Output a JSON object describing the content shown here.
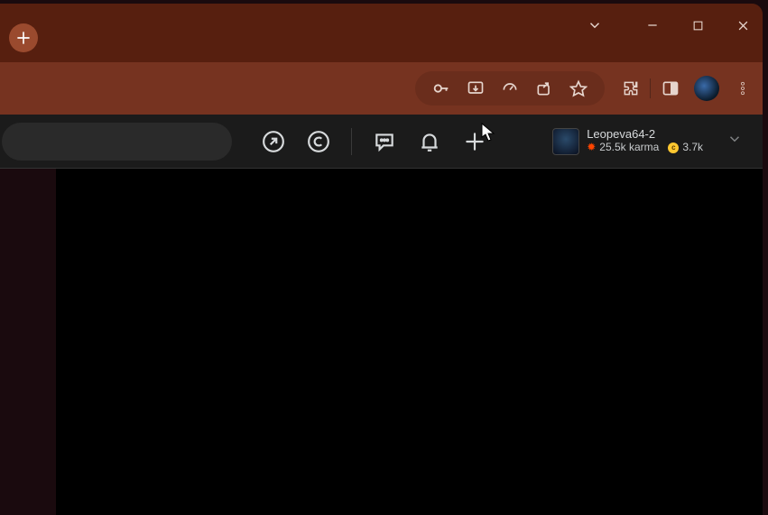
{
  "user": {
    "name": "Leopeva64-2",
    "karma_value": "25.5k",
    "karma_suffix": " karma",
    "coins": "3.7k"
  },
  "icons": {
    "new_tab": "plus",
    "sync": "chevron-down",
    "minimize": "minimize",
    "maximize": "maximize",
    "close": "close",
    "password": "key",
    "install": "install",
    "speed": "gauge",
    "share": "share",
    "bookmark": "star",
    "extensions": "puzzle",
    "side_panel": "panel",
    "chrome_menu": "dots-v",
    "popular": "arrow-up-right-circle",
    "coin_badge": "coin-c",
    "chat": "chat-bubble",
    "notifications": "bell",
    "create": "plus",
    "user_expand": "chevron-down"
  }
}
